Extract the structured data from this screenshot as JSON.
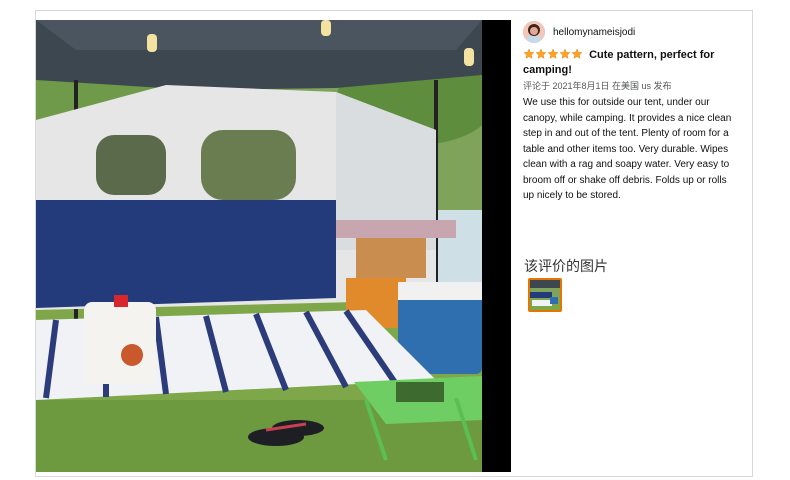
{
  "review": {
    "username": "hellomynameisjodi",
    "rating": 5,
    "rating_max": 5,
    "title": "Cute pattern, perfect for camping!",
    "meta": "评论于 2021年8月1日 在美国 us 发布",
    "body": "We use this for outside our tent, under our canopy, while camping. It provides a nice clean step in and out of the tent. Plenty of room for a table and other items too. Very durable. Wipes clean with a rag and soapy water. Very easy to broom off or shake off debris. Folds up or rolls up nicely to be stored."
  },
  "images_section": {
    "label": "该评价的图片"
  },
  "colors": {
    "star": "#ffa41c",
    "thumb_border": "#e77600",
    "text": "#0f1111"
  },
  "icons": [
    "avatar",
    "star-icon"
  ]
}
